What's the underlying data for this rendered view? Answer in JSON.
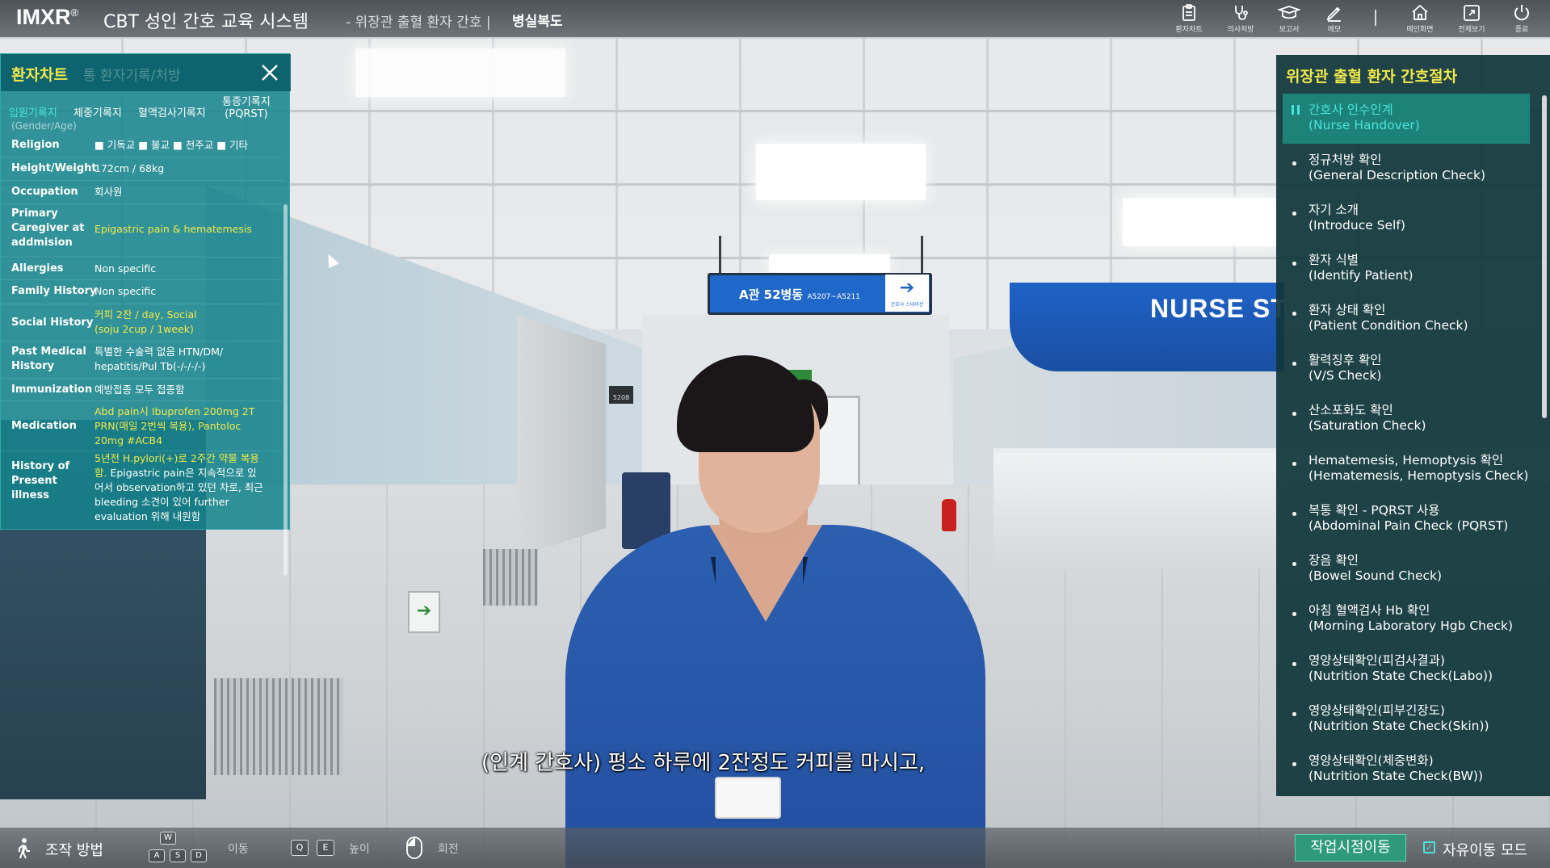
{
  "header": {
    "brand": "IMXR",
    "brand_mark": "®",
    "title": "CBT 성인 간호 교육 시스템",
    "subtitle": "- 위장관 출혈 환자 간호 |",
    "location": "병실복도",
    "tools": [
      {
        "label": "환자차트",
        "icon": "clipboard-icon"
      },
      {
        "label": "의사처방",
        "icon": "stethoscope-icon"
      },
      {
        "label": "보고서",
        "icon": "report-icon"
      },
      {
        "label": "메모",
        "icon": "pencil-icon"
      },
      {
        "label": "메인화면",
        "icon": "home-icon"
      },
      {
        "label": "전체보기",
        "icon": "fullscreen-icon"
      },
      {
        "label": "종료",
        "icon": "power-icon"
      }
    ]
  },
  "chart_panel": {
    "title": "환자차트",
    "title_ghost": "통 환자기록/처방",
    "tabs": [
      {
        "label": "입원기록지",
        "active": true
      },
      {
        "label": "체중기록지",
        "active": false
      },
      {
        "label": "혈액검사기록지",
        "active": false
      },
      {
        "label_line1": "통증기록지",
        "label_line2": "(PQRST)",
        "active": false
      }
    ],
    "cut_row": "(Gender/Age)",
    "rows": [
      {
        "label": "Religion",
        "value": "■ 기독교 ■ 불교 ■ 천주교 ■ 기타",
        "highlight": false
      },
      {
        "label": "Height/Weight",
        "value": "172cm / 68kg",
        "highlight": false
      },
      {
        "label": "Occupation",
        "value": "회사원",
        "highlight": false
      },
      {
        "label": "Primary Caregiver at addmision",
        "value": "Epigastric pain & hematemesis",
        "highlight": true
      },
      {
        "label": "Allergies",
        "value": "Non specific",
        "highlight": false
      },
      {
        "label": "Family History",
        "value": "Non specific",
        "highlight": false
      },
      {
        "label": "Social History",
        "value": "커피 2잔 / day, Social (soju 2cup / 1week)",
        "highlight": true
      },
      {
        "label": "Past Medical History",
        "value": "특별한 수술력 없음 HTN/DM/ hepatitis/Pul Tb(-/-/-/-)",
        "highlight": false
      },
      {
        "label": "Immunization",
        "value": "예방접종 모두 접종함",
        "highlight": false
      },
      {
        "label": "Medication",
        "value": "Abd pain시 Ibuprofen 200mg 2T PRN(매일 2번씩 복용), Pantoloc 20mg #ACB4",
        "highlight": true
      },
      {
        "label": "History of Present illness",
        "value_hl": "5년전 H.pylori(+)로 2주간 약물 복용함.",
        "value": " Epigastric pain은 지속적으로 있어서 observation하고 있던 차로, 최근 bleeding 소견이 있어 further evaluation 위해 내원함",
        "highlight": true
      }
    ]
  },
  "proc_panel": {
    "title": "위장관 출혈 환자 간호절차",
    "items": [
      {
        "ko": "간호사 인수인계",
        "en": "(Nurse Handover)",
        "active": true
      },
      {
        "ko": "정규처방 확인",
        "en": "(General Description Check)",
        "active": false
      },
      {
        "ko": "자기 소개",
        "en": "(Introduce Self)",
        "active": false
      },
      {
        "ko": "환자 식별",
        "en": "(Identify Patient)",
        "active": false
      },
      {
        "ko": "환자 상태 확인",
        "en": "(Patient Condition Check)",
        "active": false
      },
      {
        "ko": "활력징후 확인",
        "en": "(V/S Check)",
        "active": false
      },
      {
        "ko": "산소포화도 확인",
        "en": "(Saturation Check)",
        "active": false
      },
      {
        "ko": "Hematemesis, Hemoptysis 확인",
        "en": "(Hematemesis, Hemoptysis Check)",
        "active": false
      },
      {
        "ko": "복통 확인 - PQRST 사용",
        "en": "(Abdominal Pain Check (PQRST)",
        "active": false
      },
      {
        "ko": "장음 확인",
        "en": "(Bowel Sound Check)",
        "active": false
      },
      {
        "ko": "아침 혈액검사 Hb 확인",
        "en": "(Morning Laboratory Hgb Check)",
        "active": false
      },
      {
        "ko": "영양상태확인(피검사결과)",
        "en": "(Nutrition State Check(Labo))",
        "active": false
      },
      {
        "ko": "영양상태확인(피부긴장도)",
        "en": "(Nutrition State Check(Skin))",
        "active": false
      },
      {
        "ko": "영양상태확인(체중변화)",
        "en": "(Nutrition State Check(BW))",
        "active": false
      }
    ]
  },
  "scene": {
    "sign_ward": "A관 52병동",
    "sign_rooms": "A5207~A5211",
    "sign_sub": "간호사 스테이션",
    "nurse_station": "NURSE STA",
    "room_number": "5208"
  },
  "subtitle": "(인계 간호사) 평소 하루에 2잔정도 커피를 마시고,",
  "footer": {
    "controls_label": "조작 방법",
    "keys_move": [
      "W",
      "A",
      "S",
      "D"
    ],
    "move_label": "이동",
    "keys_height": [
      "Q",
      "E"
    ],
    "height_label": "높이",
    "rotate_label": "회전",
    "work_button": "작업시점이동",
    "free_mode": "자유이동 모드",
    "free_mode_checked": true
  },
  "colors": {
    "accent_yellow": "#f1e94a",
    "accent_cyan": "#49e3d9",
    "panel_teal": "#14848c",
    "proc_bg": "#10363a",
    "button_green": "#2f9a7b"
  }
}
